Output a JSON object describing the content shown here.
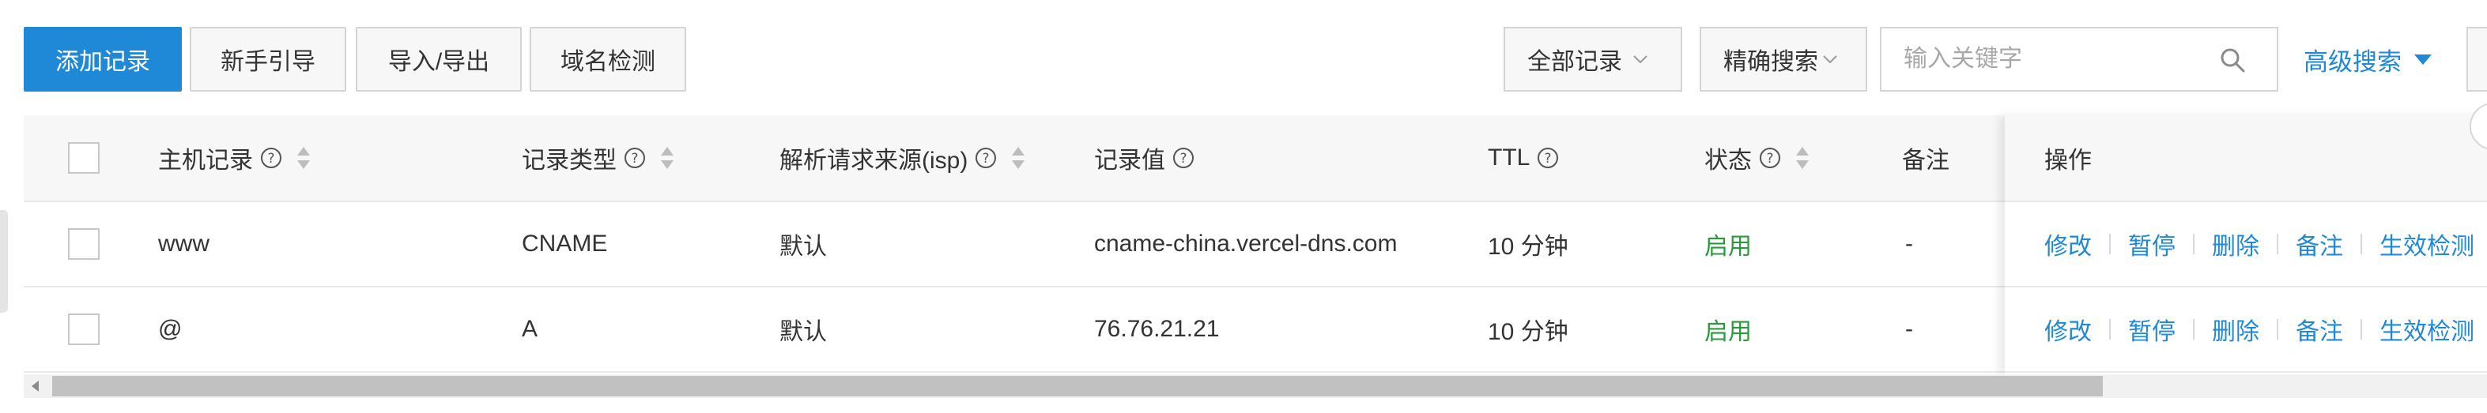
{
  "toolbar": {
    "add_label": "添加记录",
    "guide_label": "新手引导",
    "import_export_label": "导入/导出",
    "domain_check_label": "域名检测",
    "filter_select": "全部记录",
    "search_mode_select": "精确搜索",
    "search_placeholder": "输入关键字",
    "advanced_search_label": "高级搜索"
  },
  "table": {
    "headers": {
      "host": "主机记录",
      "type": "记录类型",
      "line": "解析请求来源(isp)",
      "value": "记录值",
      "ttl": "TTL",
      "status": "状态",
      "remark": "备注",
      "ops": "操作"
    },
    "rows": [
      {
        "host": "www",
        "type": "CNAME",
        "line": "默认",
        "value": "cname-china.vercel-dns.com",
        "ttl": "10 分钟",
        "status": "启用",
        "remark": "-"
      },
      {
        "host": "@",
        "type": "A",
        "line": "默认",
        "value": "76.76.21.21",
        "ttl": "10 分钟",
        "status": "启用",
        "remark": "-"
      }
    ],
    "row_actions": {
      "modify": "修改",
      "pause": "暂停",
      "delete": "删除",
      "remark": "备注",
      "verify": "生效检测"
    }
  },
  "colors": {
    "primary": "#1f89d8",
    "status_enabled": "#2a9a3c"
  },
  "icons": {
    "help": "question-circle-icon",
    "sort": "sort-icon",
    "search": "search-icon",
    "chevron": "chevron-down-icon"
  }
}
